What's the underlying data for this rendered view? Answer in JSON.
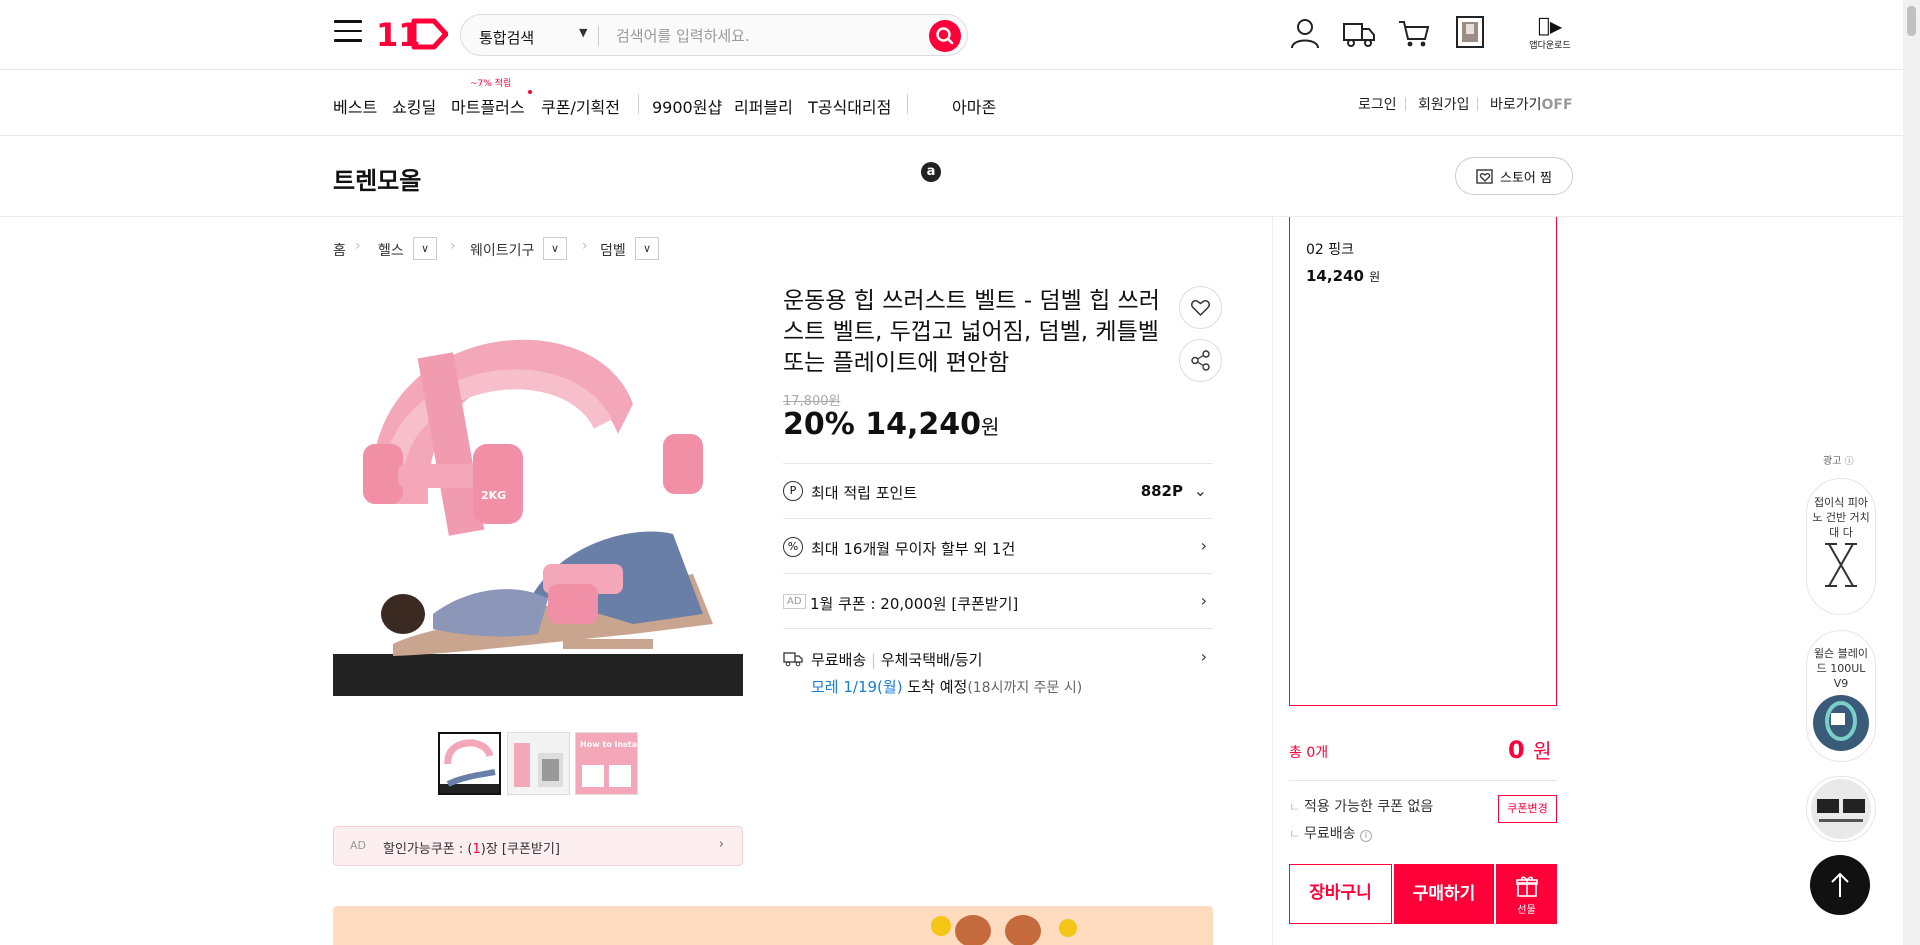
{
  "header": {
    "logo_text": "11",
    "search": {
      "scope": "통합검색",
      "placeholder": "검색어를 입력하세요."
    },
    "app_download": "앱다운로드"
  },
  "nav": {
    "items": [
      "베스트",
      "쇼킹딜",
      "마트플러스",
      "쿠폰/기획전",
      "9900원샵",
      "리퍼블리",
      "T공식대리점",
      "아마존"
    ],
    "mart_badge": "~7% 적립",
    "util": {
      "login": "로그인",
      "join": "회원가입",
      "shortcut": "바로가기",
      "shortcut_state": "OFF"
    }
  },
  "store": {
    "name": "트렌모올",
    "fav_label": "스토어 찜"
  },
  "breadcrumb": [
    "홈",
    "헬스",
    "웨이트기구",
    "덤벨"
  ],
  "product": {
    "title": "운동용 힙 쓰러스트 벨트 - 덤벨 힙 쓰러스트 벨트, 두껍고 넓어짐, 덤벨, 케틀벨 또는 플레이트에 편안함",
    "original_price": "17,800원",
    "discount": "20%",
    "price": "14,240",
    "price_unit": "원",
    "image_label": "2KG",
    "thumb_label": "How to Install"
  },
  "info": {
    "points_label": "최대 적립 포인트",
    "points_value": "882P",
    "installment": "최대 16개월 무이자 할부 외 1건",
    "ad_tag": "AD",
    "coupon": "1월 쿠폰 : 20,000원 [쿠폰받기]",
    "shipping_free": "무료배송",
    "shipping_method": "우체국택배/등기",
    "arrival_date": "모레 1/19(월)",
    "arrival_text": "도착 예정",
    "arrival_note": "(18시까지 주문 시)"
  },
  "coupon_bar": {
    "ad": "AD",
    "prefix": "할인가능쿠폰 : (",
    "count": "1",
    "suffix": ")장 [쿠폰받기]"
  },
  "order": {
    "option_name": "02 핑크",
    "option_price": "14,240",
    "option_unit": "원",
    "total_label": "총 0개",
    "total_value": "0",
    "total_unit": "원",
    "no_coupon": "적용 가능한 쿠폰 없음",
    "coupon_change": "쿠폰변경",
    "free_shipping": "무료배송",
    "cart": "장바구니",
    "buy": "구매하기",
    "gift": "선물"
  },
  "side_ads": {
    "label": "광고",
    "ad1": "접이식 피아노 건반 거치대 다",
    "ad2": "윌슨 블레이드 100UL V9"
  },
  "colors": {
    "brand": "#ff0038",
    "link_blue": "#1a7dd6"
  }
}
